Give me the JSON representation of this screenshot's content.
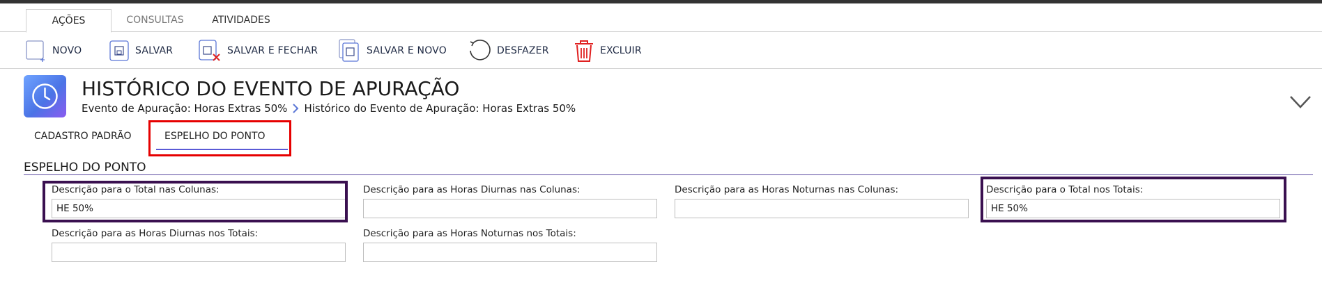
{
  "ribbon": {
    "tabs": [
      {
        "label": "AÇÕES",
        "active": true
      },
      {
        "label": "CONSULTAS",
        "active": false
      },
      {
        "label": "ATIVIDADES",
        "active": false
      }
    ]
  },
  "toolbar": {
    "novo": "NOVO",
    "salvar": "SALVAR",
    "salvar_fechar": "SALVAR E FECHAR",
    "salvar_novo": "SALVAR E NOVO",
    "desfazer": "DESFAZER",
    "excluir": "EXCLUIR"
  },
  "header": {
    "title": "HISTÓRICO DO EVENTO DE APURAÇÃO",
    "breadcrumb": [
      "Evento de Apuração: Horas Extras 50%",
      "Histórico do Evento de Apuração: Horas Extras 50%"
    ],
    "icon": "clock-icon",
    "icon_color": "#5b83ee"
  },
  "subtabs": [
    {
      "label": "CADASTRO PADRÃO",
      "active": false
    },
    {
      "label": "ESPELHO DO PONTO",
      "active": true
    }
  ],
  "section": {
    "title": "ESPELHO DO PONTO",
    "fields": [
      {
        "label": "Descrição para o Total nas Colunas:",
        "value": "HE 50%"
      },
      {
        "label": "Descrição para as Horas Diurnas nas Colunas:",
        "value": ""
      },
      {
        "label": "Descrição para as Horas Noturnas nas Colunas:",
        "value": ""
      },
      {
        "label": "Descrição para o Total nos Totais:",
        "value": "HE 50%"
      },
      {
        "label": "Descrição para as Horas Diurnas nos Totais:",
        "value": ""
      },
      {
        "label": "Descrição para as Horas Noturnas nos Totais:",
        "value": ""
      }
    ]
  },
  "colors": {
    "highlight_red": "#e60000",
    "highlight_purple": "#3a1050",
    "accent_purple": "#5a5ad6",
    "delete_red": "#e02020",
    "topbar": "#333333"
  }
}
